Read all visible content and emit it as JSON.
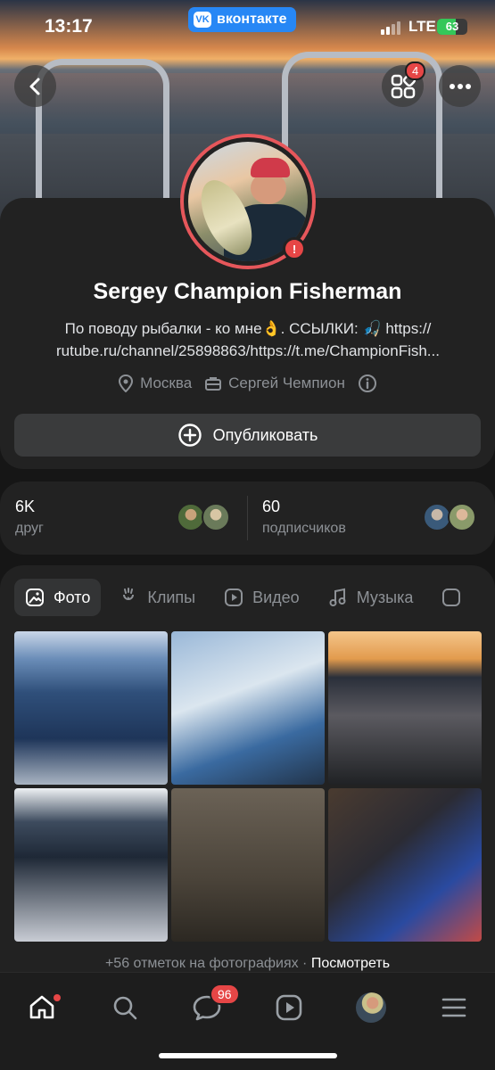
{
  "status_bar": {
    "time": "13:17",
    "network": "LTE",
    "battery": "63",
    "battery_level": 0.63,
    "app_pill": "вконтакте",
    "app_pill_logo": "VK"
  },
  "top_actions": {
    "apps_badge": "4"
  },
  "profile": {
    "name": "Sergey Champion Fisherman",
    "bio_line1": "По поводу рыбалки - ко мне👌. ССЫЛКИ: 🎣 https://",
    "bio_line2": "rutube.ru/channel/25898863/https://t.me/ChampionFish...",
    "city": "Москва",
    "work": "Сергей Чемпион",
    "alert_glyph": "!",
    "publish_label": "Опубликовать"
  },
  "friends": {
    "friends_count": "6K",
    "friends_label": "друг",
    "followers_count": "60",
    "followers_label": "подписчиков"
  },
  "media": {
    "tabs": [
      {
        "label": "Фото",
        "icon": "photo-icon"
      },
      {
        "label": "Клипы",
        "icon": "clips-icon"
      },
      {
        "label": "Видео",
        "icon": "video-icon"
      },
      {
        "label": "Музыка",
        "icon": "music-icon"
      }
    ],
    "photos_count": 6,
    "tags_text": "+56 отметок на фотографиях · ",
    "tags_link": "Посмотреть"
  },
  "bottom_nav": {
    "items": [
      "home-icon",
      "search-icon",
      "messages-icon",
      "video-icon",
      "profile-avatar",
      "menu-icon"
    ],
    "messages_badge": "96"
  },
  "colors": {
    "accent": "#2787f5",
    "badge": "#e64646",
    "avatar_ring": "#e6575b",
    "card": "#222222",
    "background": "#161616"
  }
}
